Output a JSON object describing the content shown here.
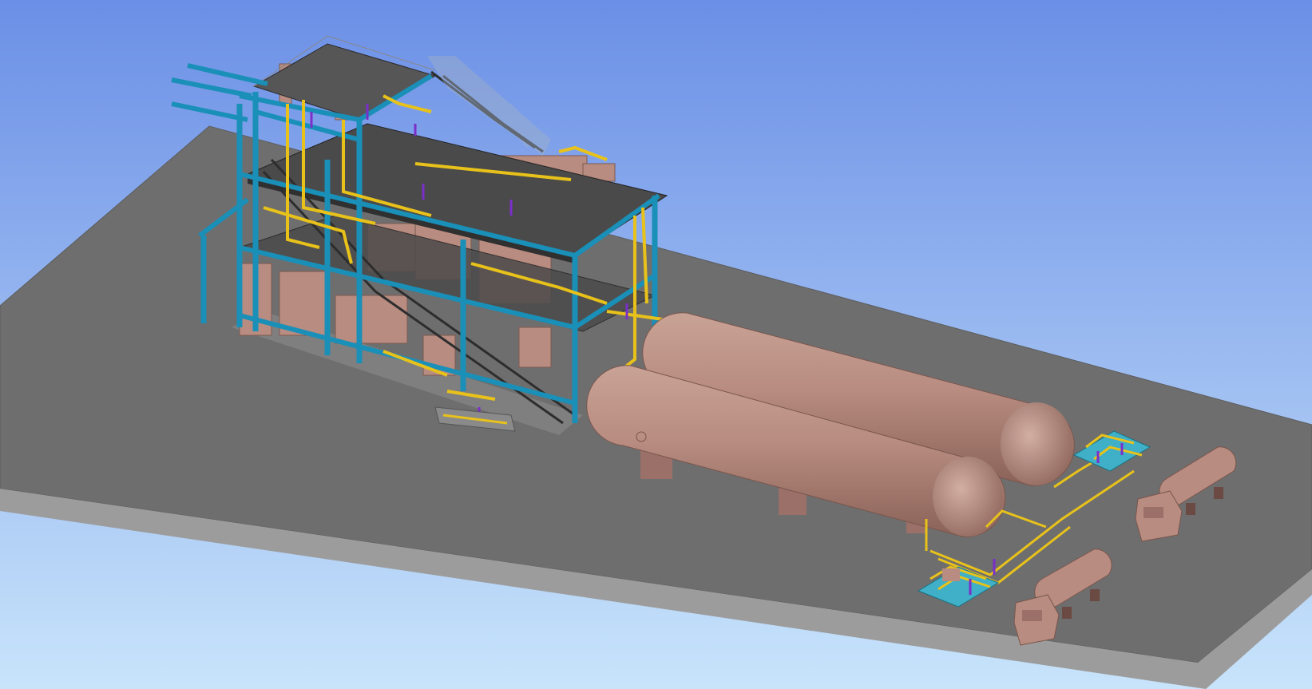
{
  "viewport": {
    "background_top": "#6b8fe6",
    "background_bottom": "#c8e4fb"
  },
  "colors": {
    "ground_top": "#6e6e6e",
    "ground_front": "#9a9a9a",
    "structure_steel": "#1a8fb8",
    "piping": "#e8c21a",
    "supports": "#7b2fc9",
    "equipment": "#b98e84",
    "grating": "#3a3a3a",
    "glass": "#9fb0c8"
  },
  "scene_objects": [
    "ground-slab",
    "process-structure",
    "storage-tank-1",
    "storage-tank-2",
    "loading-skid-1",
    "loading-skid-2",
    "tanker-truck-1",
    "tanker-truck-2"
  ]
}
